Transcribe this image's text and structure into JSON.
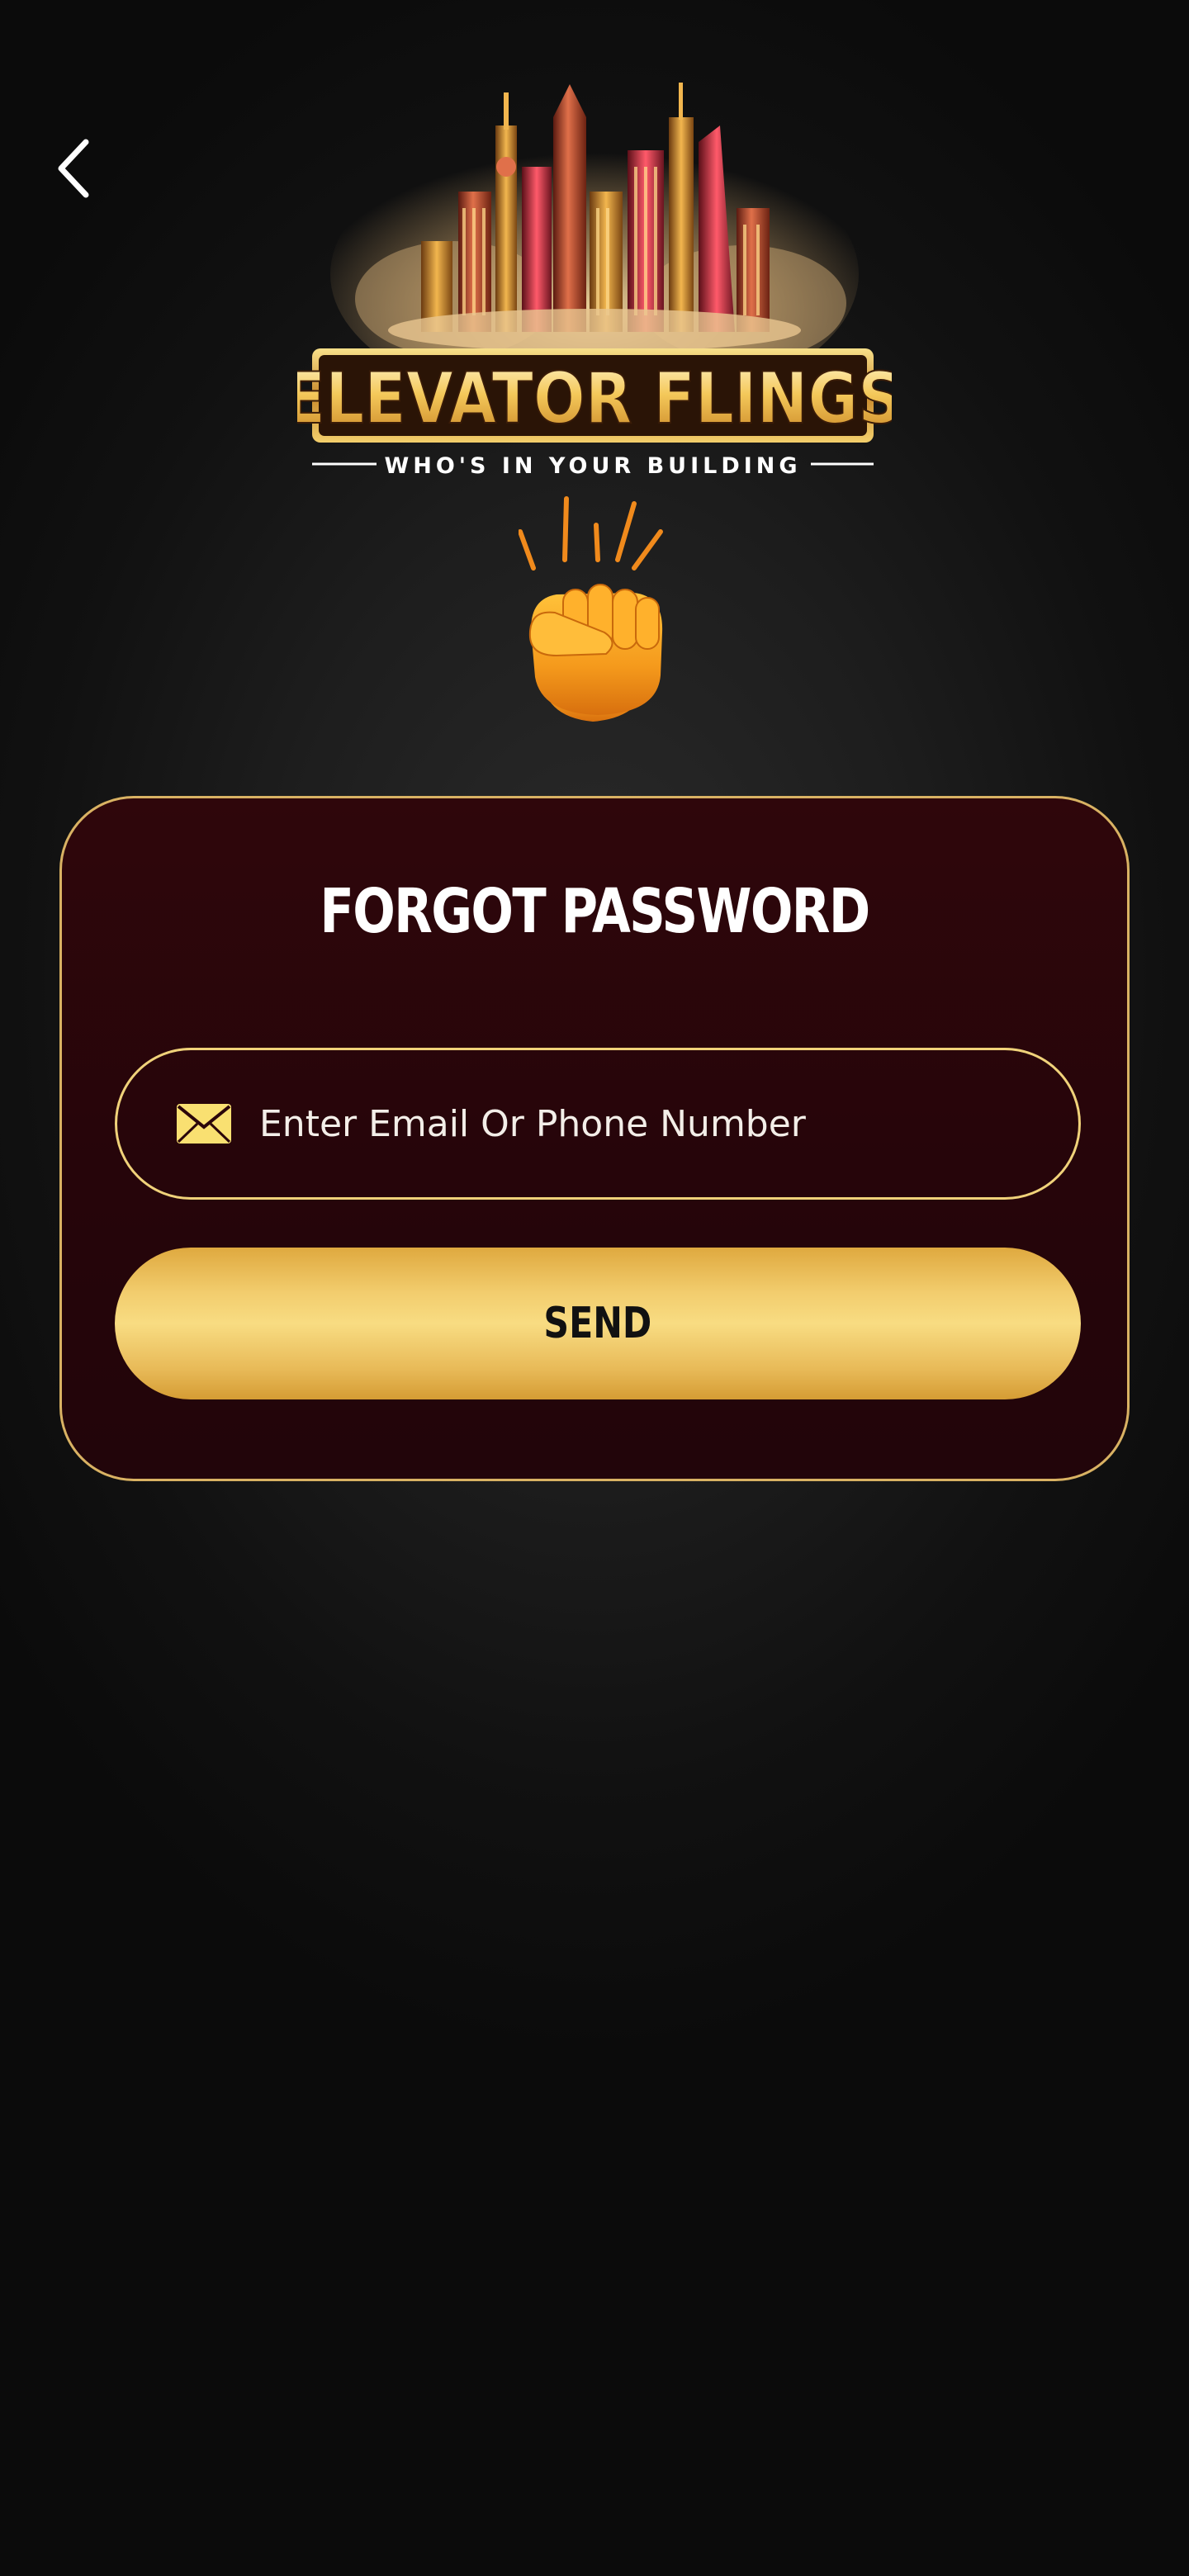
{
  "logo": {
    "wordmark": "ELEVATOR FLINGS",
    "tagline": "WHO'S IN YOUR BUILDING"
  },
  "card": {
    "title": "FORGOT PASSWORD"
  },
  "form": {
    "email_placeholder": "Enter Email Or Phone Number",
    "email_value": "",
    "send_label": "SEND"
  },
  "icons": {
    "back": "chevron-left-icon",
    "field": "mail-icon",
    "emoji": "raised-fist-icon"
  },
  "colors": {
    "accent_gold": "#f0d27a",
    "card_background": "#2a050a",
    "button_gold": "#f2cd6e",
    "page_background": "#1b1b1b"
  }
}
